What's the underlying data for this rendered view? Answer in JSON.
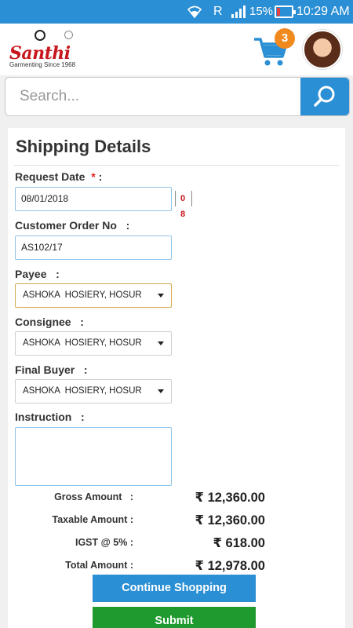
{
  "status_bar": {
    "carrier_indicator": "R",
    "battery_percent": "15%",
    "time": "10:29 AM",
    "icons": [
      "wifi-icon",
      "signal-icon",
      "battery-icon"
    ]
  },
  "header": {
    "brand": "Santhi",
    "tagline": "Garmenting Since 1968",
    "cart_count": "3"
  },
  "search": {
    "placeholder": "Search..."
  },
  "form": {
    "title": "Shipping Details",
    "request_date_label": "Request Date",
    "required_mark": "*",
    "request_date_colon": ":",
    "request_date_value": "08/01/2018",
    "calendar_icon_text": "0 8",
    "customer_order_label": "Customer Order No   :",
    "customer_order_value": "AS102/17",
    "payee_label": "Payee   :",
    "payee_value": "ASHOKA  HOSIERY, HOSUR",
    "consignee_label": "Consignee   :",
    "consignee_value": "ASHOKA  HOSIERY, HOSUR",
    "final_buyer_label": "Final Buyer   :",
    "final_buyer_value": "ASHOKA  HOSIERY, HOSUR",
    "instruction_label": "Instruction   :",
    "instruction_value": ""
  },
  "totals": [
    {
      "label": "Gross Amount   :",
      "value": "₹ 12,360.00"
    },
    {
      "label": "Taxable Amount :",
      "value": "₹ 12,360.00"
    },
    {
      "label": "IGST @ 5% :",
      "value": "₹ 618.00"
    },
    {
      "label": "Total Amount :",
      "value": "₹ 12,978.00"
    }
  ],
  "buttons": {
    "continue_label": "Continue Shopping",
    "submit_label": "Submit"
  },
  "colors": {
    "primary": "#2a8fd4",
    "submit": "#1e9a2e",
    "badge": "#f08a1e",
    "brand_red": "#c8161d"
  }
}
